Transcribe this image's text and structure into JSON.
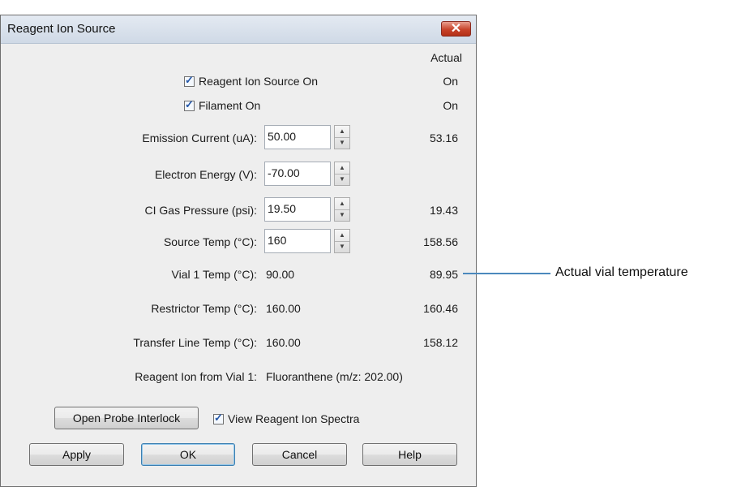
{
  "dialog": {
    "title": "Reagent Ion Source",
    "close_icon": "close-icon"
  },
  "header": {
    "actual": "Actual"
  },
  "checkboxes": {
    "reagent_source_on": {
      "label": "Reagent Ion Source On",
      "checked": true,
      "actual": "On"
    },
    "filament_on": {
      "label": "Filament On",
      "checked": true,
      "actual": "On"
    }
  },
  "fields": {
    "emission_current": {
      "label": "Emission Current (uA):",
      "value": "50.00",
      "actual": "53.16"
    },
    "electron_energy": {
      "label": "Electron Energy (V):",
      "value": "-70.00",
      "actual": ""
    },
    "ci_gas_pressure": {
      "label": "CI Gas Pressure (psi):",
      "value": "19.50",
      "actual": "19.43"
    },
    "source_temp": {
      "label": "Source Temp (°C):",
      "value": "160",
      "actual": "158.56"
    }
  },
  "readouts": {
    "vial1_temp": {
      "label": "Vial 1 Temp (°C):",
      "value": "90.00",
      "actual": "89.95"
    },
    "restrictor_temp": {
      "label": "Restrictor Temp (°C):",
      "value": "160.00",
      "actual": "160.46"
    },
    "transfer_line_temp": {
      "label": "Transfer Line Temp (°C):",
      "value": "160.00",
      "actual": "158.12"
    },
    "reagent_ion_vial1": {
      "label": "Reagent Ion from Vial 1:",
      "value": "Fluoranthene (m/z: 202.00)"
    }
  },
  "probe": {
    "open_probe_interlock": "Open Probe Interlock",
    "view_spectra": "View Reagent Ion Spectra",
    "view_spectra_checked": true
  },
  "buttons": {
    "apply": "Apply",
    "ok": "OK",
    "cancel": "Cancel",
    "help": "Help"
  },
  "callout": {
    "text": "Actual vial temperature"
  },
  "colors": {
    "callout_line": "#4b89bd",
    "close_button": "#c8432a"
  }
}
